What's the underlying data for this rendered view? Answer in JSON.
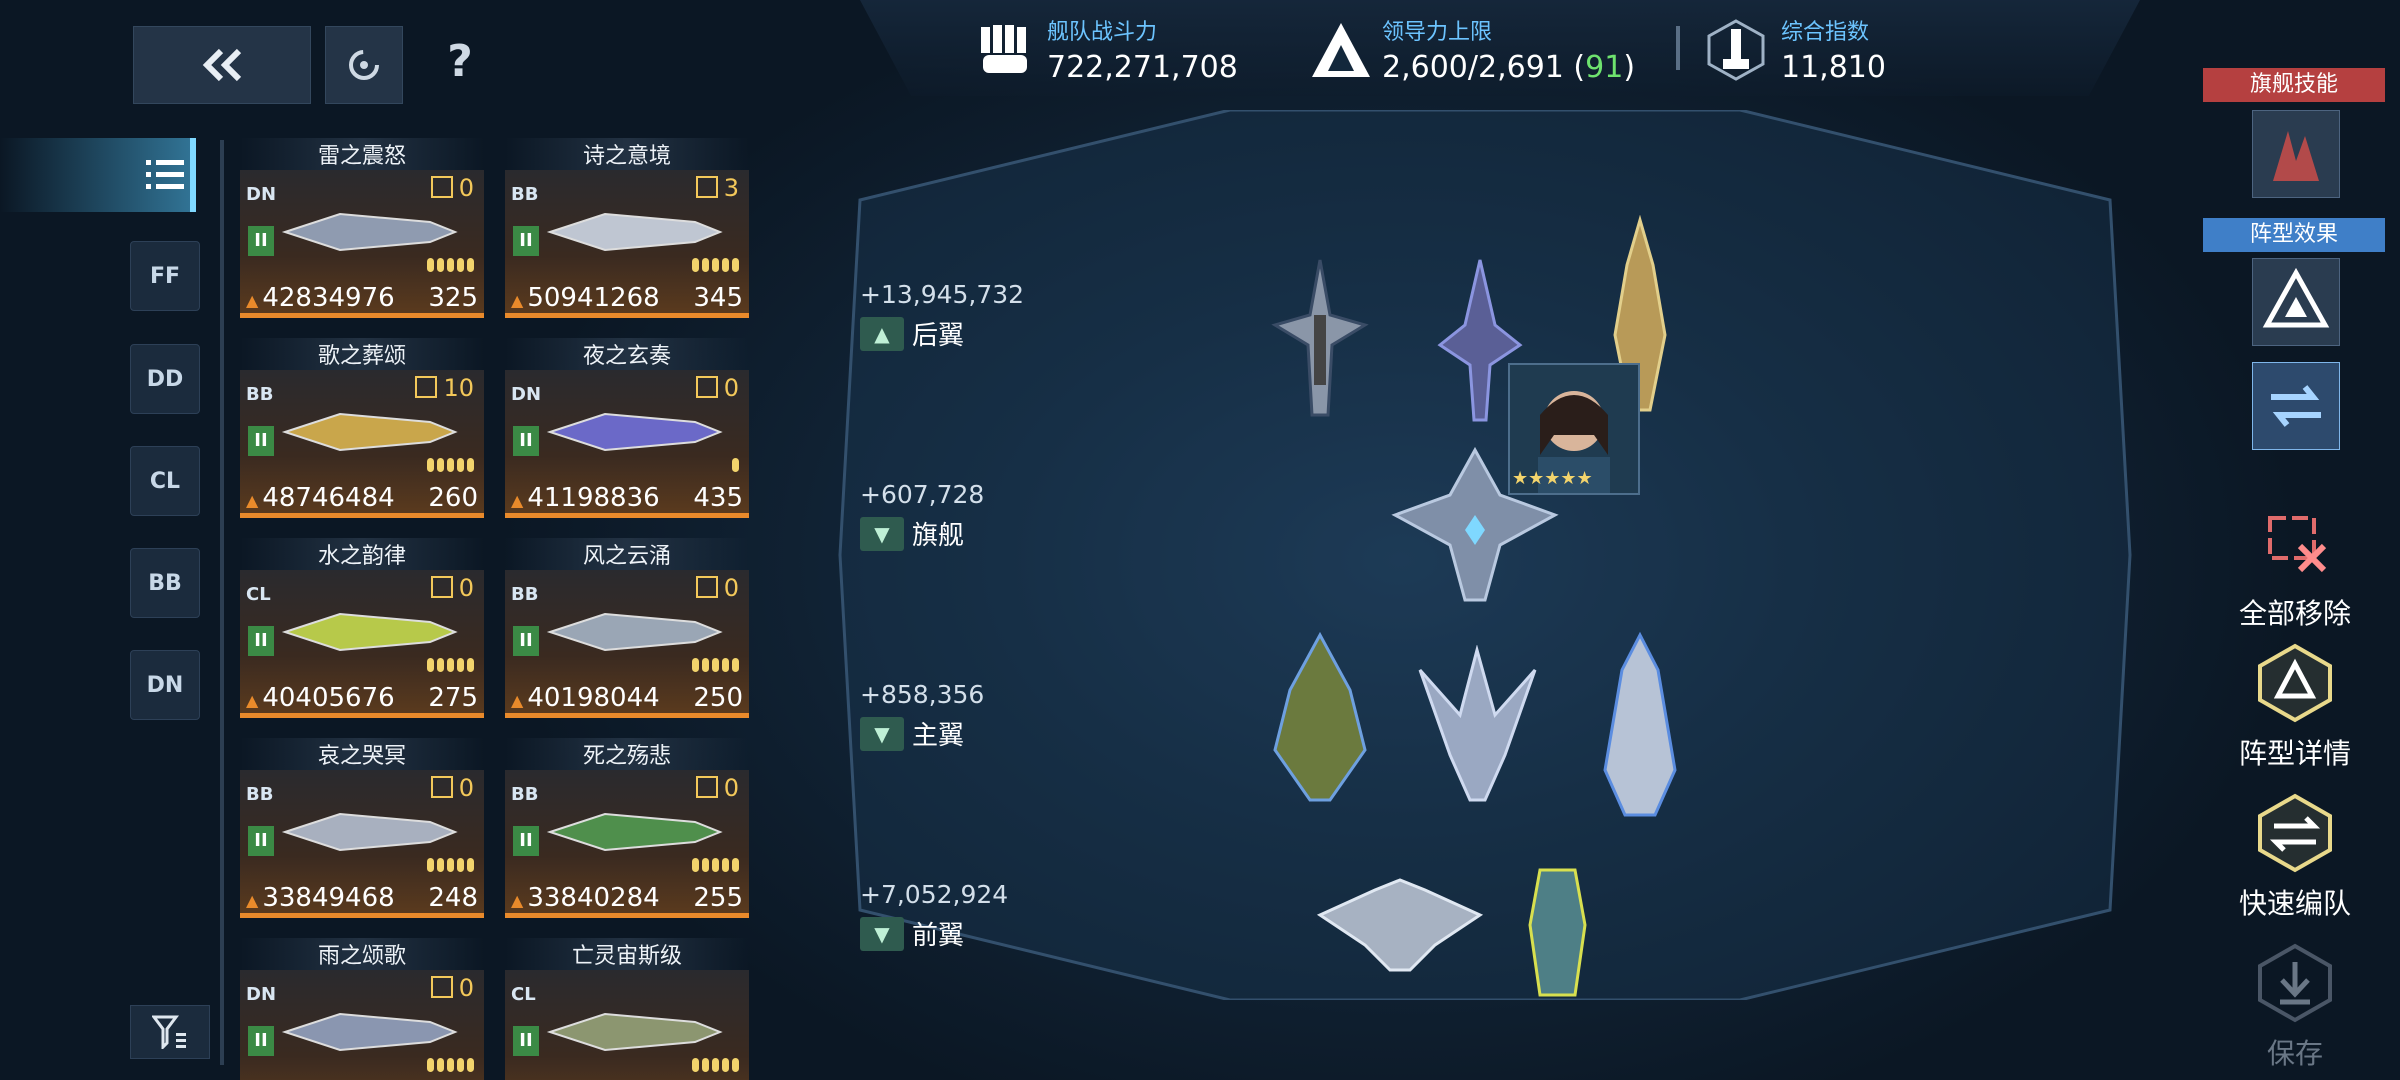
{
  "toolbar": {
    "back_icon": "double-chevron-left-icon",
    "refresh_icon": "refresh-icon",
    "help_label": "?"
  },
  "stats": {
    "fleet_power": {
      "label": "舰队战斗力",
      "value": "722,271,708"
    },
    "leadership": {
      "label": "领导力上限",
      "value": "2,600/2,691 (",
      "extra": "91",
      "close": ")"
    },
    "index": {
      "label": "综合指数",
      "value": "11,810"
    }
  },
  "class_filters": [
    "FF",
    "DD",
    "CL",
    "BB",
    "DN"
  ],
  "ships": [
    {
      "name": "雷之震怒",
      "cls": "DN",
      "lvl": "0",
      "power": "42834976",
      "cost": "325",
      "pips": 5
    },
    {
      "name": "诗之意境",
      "cls": "BB",
      "lvl": "3",
      "power": "50941268",
      "cost": "345",
      "pips": 5
    },
    {
      "name": "歌之葬颂",
      "cls": "BB",
      "lvl": "10",
      "power": "48746484",
      "cost": "260",
      "pips": 5
    },
    {
      "name": "夜之玄奏",
      "cls": "DN",
      "lvl": "0",
      "power": "41198836",
      "cost": "435",
      "pips": 1
    },
    {
      "name": "水之韵律",
      "cls": "CL",
      "lvl": "0",
      "power": "40405676",
      "cost": "275",
      "pips": 5
    },
    {
      "name": "风之云涌",
      "cls": "BB",
      "lvl": "0",
      "power": "40198044",
      "cost": "250",
      "pips": 5
    },
    {
      "name": "哀之哭冥",
      "cls": "BB",
      "lvl": "0",
      "power": "33849468",
      "cost": "248",
      "pips": 5
    },
    {
      "name": "死之殇悲",
      "cls": "BB",
      "lvl": "0",
      "power": "33840284",
      "cost": "255",
      "pips": 5
    },
    {
      "name": "雨之颂歌",
      "cls": "DN",
      "lvl": "0",
      "power": "",
      "cost": "",
      "pips": 5
    },
    {
      "name": "亡灵宙斯级",
      "cls": "CL",
      "lvl": "",
      "power": "",
      "cost": "",
      "pips": 5
    }
  ],
  "formation": {
    "rows": [
      {
        "power": "+13,945,732",
        "label": "后翼"
      },
      {
        "power": "+607,728",
        "label": "旗舰"
      },
      {
        "power": "+858,356",
        "label": "主翼"
      },
      {
        "power": "+7,052,924",
        "label": "前翼"
      }
    ]
  },
  "right_panel": {
    "flagship_skill": "旗舰技能",
    "formation_effect": "阵型效果",
    "remove_all": "全部移除",
    "formation_detail": "阵型详情",
    "quick_form": "快速编队",
    "save": "保存"
  },
  "colors": {
    "accent": "#6cc4ff",
    "card_border": "#e98a2b",
    "green": "#6ee26e",
    "skill_red": "#b54040",
    "effect_blue": "#3f7fc8"
  }
}
